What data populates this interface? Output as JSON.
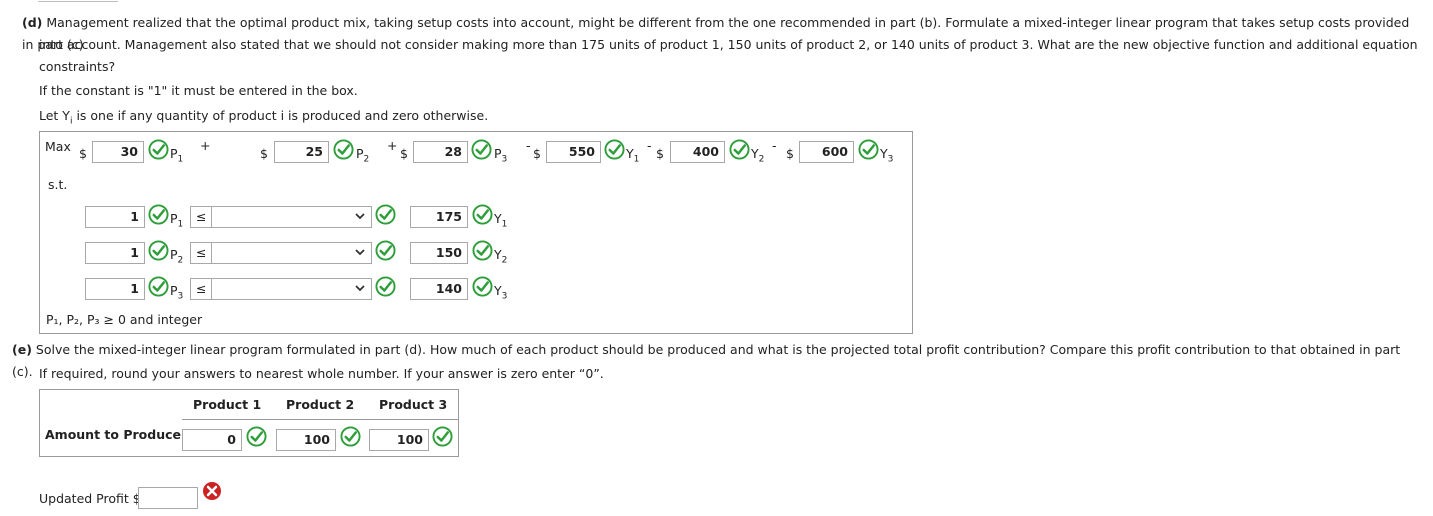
{
  "question_d": {
    "label": "(d)",
    "text_line1": "Management realized that the optimal product mix, taking setup costs into account, might be different from the one recommended in part (b). Formulate a mixed-integer linear program that takes setup costs provided in part (c)",
    "text_line2": "into account. Management also stated that we should not consider making more than 175 units of product 1, 150 units of product 2, or 140 units of product 3. What are the new objective function and additional equation",
    "text_line3": "constraints?",
    "note_constant": "If the constant is \"1\" it must be entered in the box.",
    "note_y": "Let Y",
    "note_y_sub": "i",
    "note_y_rest": " is one if any quantity of product i is produced and zero otherwise."
  },
  "objective": {
    "max_label": "Max",
    "st_label": "s.t.",
    "dollar": "$",
    "plus": "+",
    "minus": "-",
    "coef_p1": "30",
    "coef_p2": "25",
    "coef_p3": "28",
    "coef_y1": "550",
    "coef_y2": "400",
    "coef_y3": "600",
    "var_p": "P",
    "var_y": "Y",
    "sub1": "1",
    "sub2": "2",
    "sub3": "3"
  },
  "constraints": [
    {
      "coef": "1",
      "var_sub": "1",
      "op": "≤",
      "rhs": "175",
      "y_sub": "1"
    },
    {
      "coef": "1",
      "var_sub": "2",
      "op": "≤",
      "rhs": "150",
      "y_sub": "2"
    },
    {
      "coef": "1",
      "var_sub": "3",
      "op": "≤",
      "rhs": "140",
      "y_sub": "3"
    }
  ],
  "integer_line": "P₁, P₂, P₃ ≥ 0 and integer",
  "question_e": {
    "label": "(e)",
    "text": "Solve the mixed-integer linear program formulated in part (d). How much of each product should be produced and what is the projected total profit contribution? Compare this profit contribution to that obtained in part (c).",
    "note": "If required, round your answers to nearest whole number. If your answer is zero enter “0”."
  },
  "result_table": {
    "headers": [
      "Product 1",
      "Product 2",
      "Product 3"
    ],
    "row_label": "Amount to Produce",
    "values": [
      "0",
      "100",
      "100"
    ]
  },
  "updated_profit": {
    "label": "Updated Profit $",
    "value": ""
  },
  "colors": {
    "check_green": "#2e9e3a",
    "error_red": "#cc2222",
    "border": "#9a9a9a"
  }
}
